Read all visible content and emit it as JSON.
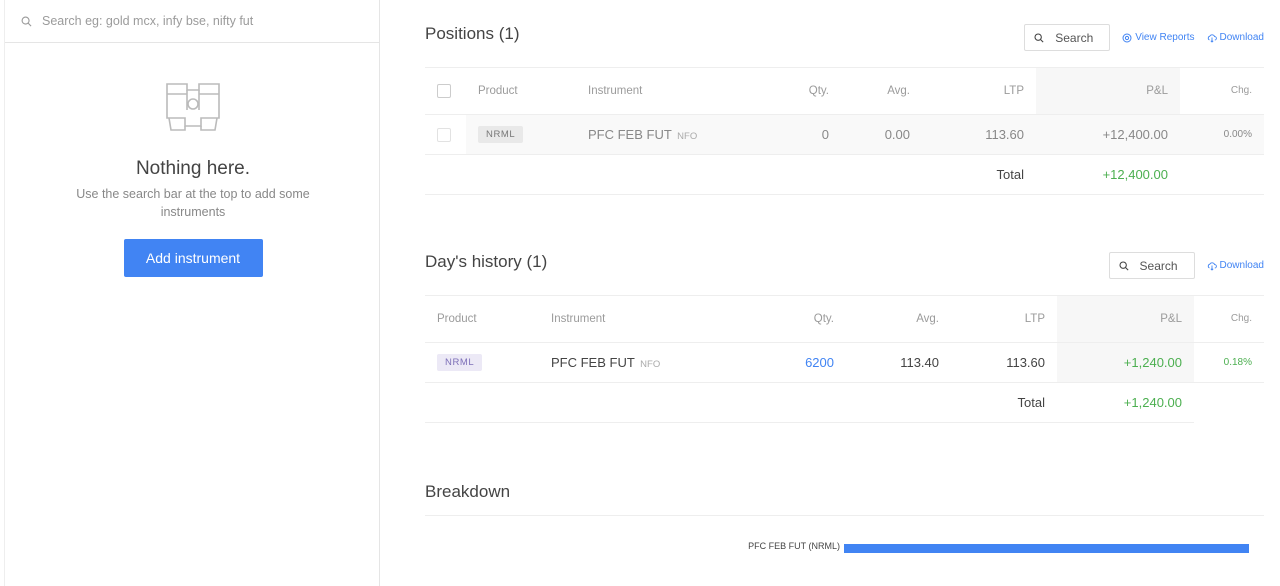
{
  "marketwatch": {
    "search_placeholder": "Search eg: gold mcx, infy bse, nifty fut",
    "empty_title": "Nothing here.",
    "empty_desc": "Use the search bar at the top to add some instruments",
    "add_button": "Add instrument"
  },
  "positions": {
    "title": "Positions (1)",
    "search_label": "Search",
    "view_reports": "View Reports",
    "download": "Download",
    "columns": [
      "Product",
      "Instrument",
      "Qty.",
      "Avg.",
      "LTP",
      "P&L",
      "Chg."
    ],
    "rows": [
      {
        "product": "NRML",
        "instrument": "PFC FEB FUT",
        "exchange": "NFO",
        "qty": "0",
        "avg": "0.00",
        "ltp": "113.60",
        "pnl": "+12,400.00",
        "chg": "0.00%"
      }
    ],
    "total_label": "Total",
    "total_value": "+12,400.00"
  },
  "history": {
    "title": "Day's history (1)",
    "search_label": "Search",
    "download": "Download",
    "columns": [
      "Product",
      "Instrument",
      "Qty.",
      "Avg.",
      "LTP",
      "P&L",
      "Chg."
    ],
    "rows": [
      {
        "product": "NRML",
        "instrument": "PFC FEB FUT",
        "exchange": "NFO",
        "qty": "6200",
        "avg": "113.40",
        "ltp": "113.60",
        "pnl": "+1,240.00",
        "chg": "0.18%"
      }
    ],
    "total_label": "Total",
    "total_value": "+1,240.00"
  },
  "breakdown": {
    "title": "Breakdown",
    "bars": [
      {
        "label": "PFC FEB FUT (NRML)",
        "share": 1.0,
        "color": "#4184f3"
      }
    ]
  },
  "colors": {
    "accent": "#4184f3",
    "profit": "#4caf50"
  }
}
